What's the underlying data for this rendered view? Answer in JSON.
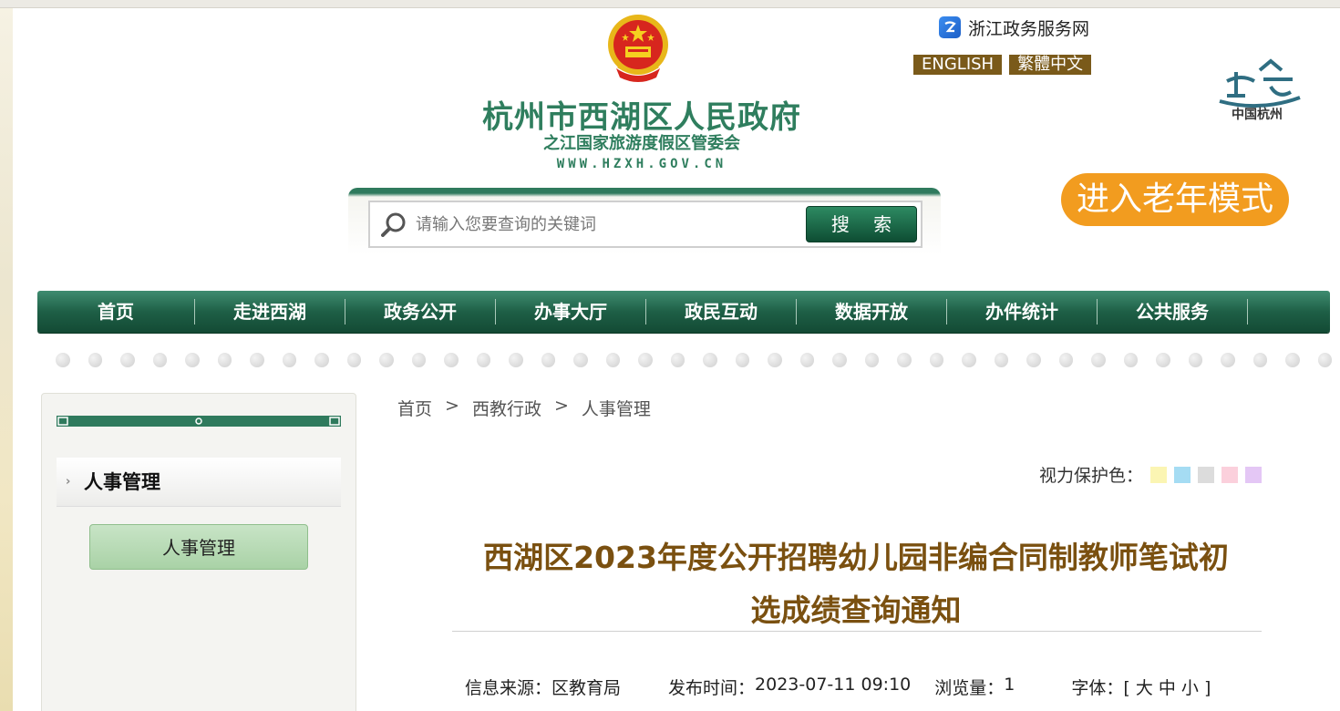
{
  "header": {
    "site_title": "杭州市西湖区人民政府",
    "site_subtitle": "之江国家旅游度假区管委会",
    "site_url": "WWW.HZXH.GOV.CN",
    "zhejiang_link": "浙江政务服务网",
    "lang_english": "ENGLISH",
    "lang_traditional": "繁體中文",
    "city_logo_text": "中国杭州",
    "elder_mode": "进入老年模式"
  },
  "search": {
    "placeholder": "请输入您要查询的关键词",
    "button": "搜 索"
  },
  "nav": {
    "items": [
      "首页",
      "走进西湖",
      "政务公开",
      "办事大厅",
      "政民互动",
      "数据开放",
      "办件统计",
      "公共服务"
    ]
  },
  "sidebar": {
    "header": "人事管理",
    "items": [
      "人事管理"
    ]
  },
  "breadcrumb": {
    "items": [
      "首页",
      "西教行政",
      "人事管理"
    ],
    "separator": ">"
  },
  "eye_care": {
    "label": "视力保护色：",
    "colors": [
      "#fbf5b3",
      "#a5dcf3",
      "#dcdcdc",
      "#fbd0dc",
      "#e4c7f5"
    ]
  },
  "article": {
    "title_line1": "西湖区2023年度公开招聘幼儿园非编合同制教师笔试初",
    "title_line2": "选成绩查询通知",
    "source_label": "信息来源：",
    "source": "区教育局",
    "date_label": "发布时间：",
    "date": "2023-07-11 09:10",
    "views_label": "浏览量：",
    "views": "1",
    "font_label": "字体：",
    "font_options": "[ 大 中 小 ]"
  },
  "colors": {
    "brand_green": "#2f7e5e",
    "nav_green": "#1e5f46",
    "title_brown": "#7a5010",
    "elder_orange": "#f29c1f"
  }
}
